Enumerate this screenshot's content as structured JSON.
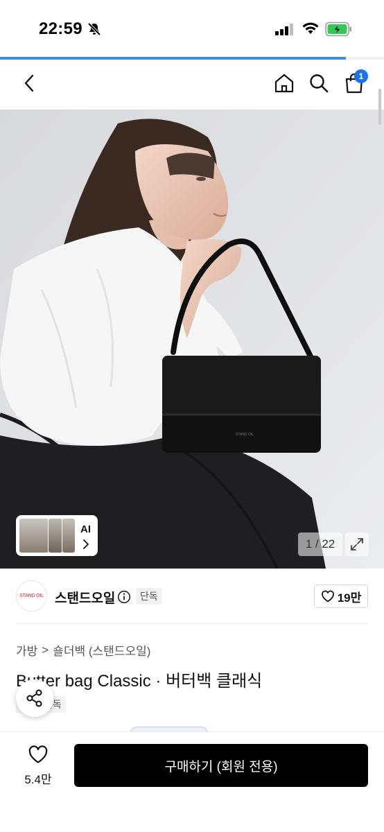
{
  "status_bar": {
    "time": "22:59",
    "icons": [
      "bell-slash-icon",
      "cellular-signal-icon",
      "wifi-icon",
      "battery-charging-icon"
    ],
    "battery_color": "#34c759"
  },
  "page_load_progress": 0.9,
  "colors": {
    "accent": "#3d8fd9",
    "badge": "#1a73e8",
    "buy_button": "#000000"
  },
  "nav": {
    "icons": [
      "back-chevron-icon",
      "home-icon",
      "search-icon",
      "cart-icon"
    ],
    "cart_count": "1"
  },
  "gallery": {
    "ai_label": "AI",
    "counter": "1 / 22"
  },
  "brand": {
    "logo_text": "STAND OIL",
    "name": "스탠드오일",
    "exclusive_tag": "단독",
    "likes": "19만"
  },
  "breadcrumb": {
    "category": "가방",
    "separator": ">",
    "subcategory": "숄더백 (스탠드오일)"
  },
  "product": {
    "title": "Butter bag Classic · 버터백 클래식",
    "exclusive_tag": "단독"
  },
  "bottom": {
    "wish_count": "5.4만",
    "buy_label": "구매하기 (회원 전용)"
  }
}
